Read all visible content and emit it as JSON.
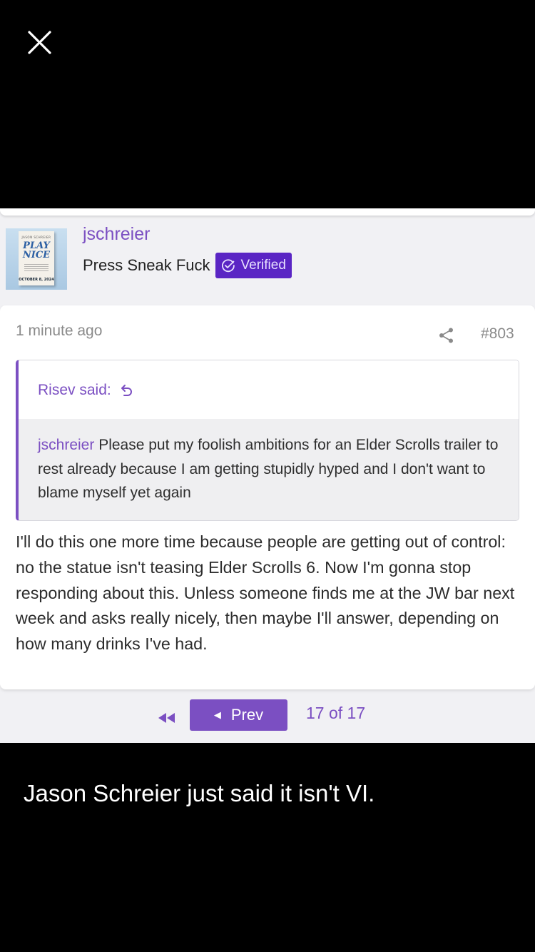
{
  "viewer": {
    "caption": "Jason Schreier just said it isn't VI."
  },
  "profile": {
    "username": "jschreier",
    "user_title": "Press Sneak Fuck",
    "badge_label": "Verified",
    "avatar": {
      "book_title": "PLAY NICE",
      "book_author": "JASON SCHREIER",
      "book_date": "OCTOBER 8, 2024"
    }
  },
  "post": {
    "time": "1 minute ago",
    "number": "#803",
    "quote": {
      "author": "Risev said:",
      "mention": "jschreier",
      "text": " Please put my foolish ambitions for an Elder Scrolls trailer to rest already because I am getting stupidly hyped and I don't want to blame myself yet again"
    },
    "body": "I'll do this one more time because people are getting out of control: no the statue isn't teasing Elder Scrolls 6. Now I'm gonna stop responding about this. Unless someone finds me at the JW bar next week and asks really nicely, then maybe I'll answer, depending on how many drinks I've had."
  },
  "pagination": {
    "prev_label": "Prev",
    "status": "17 of 17"
  },
  "icons": {
    "close": "close-icon",
    "verified": "check-circle-icon",
    "share": "share-icon",
    "reply": "reply-arrow-icon",
    "first_page": "double-chevron-left-icon",
    "prev": "caret-left-icon"
  },
  "colors": {
    "accent": "#7b4fc2",
    "badge": "#5a25c4",
    "background": "#000000",
    "card": "#ffffff",
    "page": "#f1f1f4"
  }
}
